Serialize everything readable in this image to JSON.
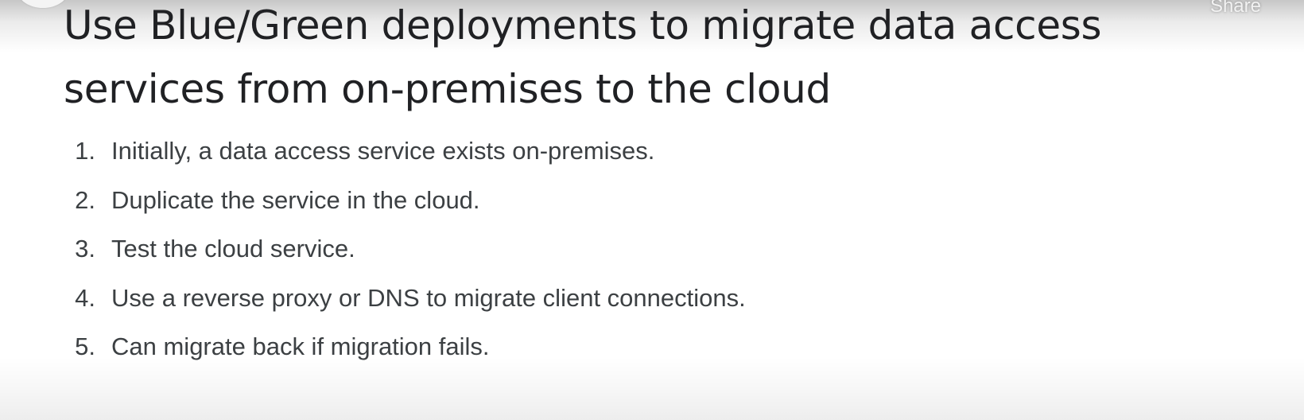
{
  "header": {
    "share_label": "Share"
  },
  "slide": {
    "title": "Use Blue/Green deployments to migrate data access services from on-premises to the cloud",
    "steps": [
      {
        "number": "1.",
        "text": "Initially, a data access service exists on-premises."
      },
      {
        "number": "2.",
        "text": "Duplicate the service in the cloud."
      },
      {
        "number": "3.",
        "text": "Test the cloud service."
      },
      {
        "number": "4.",
        "text": "Use a reverse proxy or DNS to migrate client connections."
      },
      {
        "number": "5.",
        "text": "Can migrate back if migration fails."
      }
    ]
  }
}
